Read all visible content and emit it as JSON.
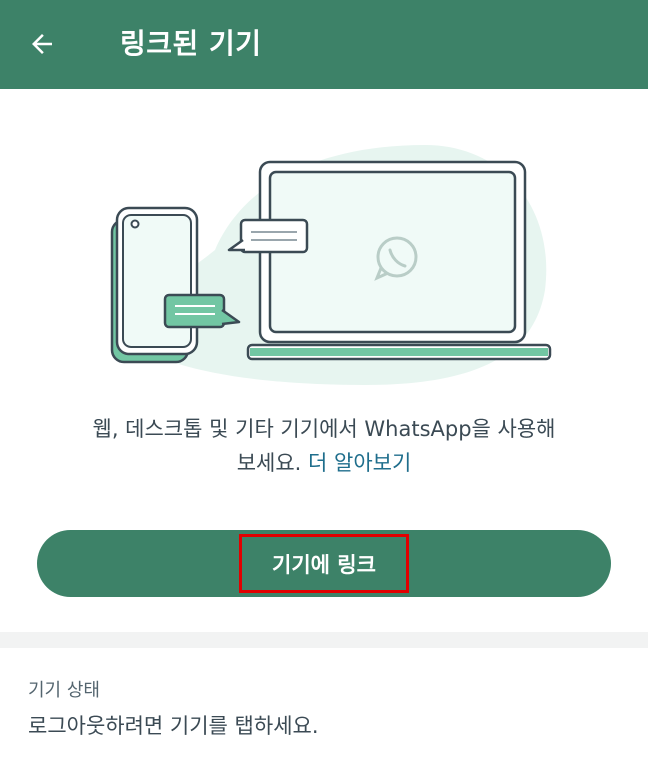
{
  "header": {
    "title": "링크된 기기"
  },
  "intro": {
    "text": "웹, 데스크톱 및 기타 기기에서 WhatsApp을 사용해",
    "text2": "보세요.",
    "learn_more": "더 알아보기"
  },
  "link_button": {
    "label": "기기에 링크"
  },
  "device_status": {
    "heading": "기기 상태",
    "hint": "로그아웃하려면 기기를 탭하세요."
  },
  "colors": {
    "accent": "#3d8268",
    "link": "#1f6e8c",
    "highlight": "#e10000"
  }
}
